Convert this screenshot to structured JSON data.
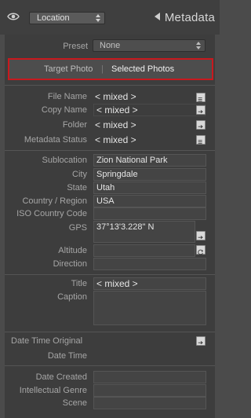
{
  "header": {
    "location_select": "Location",
    "panel_title": "Metadata"
  },
  "preset": {
    "label": "Preset",
    "value": "None"
  },
  "target": {
    "target_photo": "Target Photo",
    "separator": "|",
    "selected_photos": "Selected Photos"
  },
  "file_info": {
    "file_name": {
      "label": "File Name",
      "value": "< mixed >"
    },
    "copy_name": {
      "label": "Copy Name",
      "value": "< mixed >"
    },
    "folder": {
      "label": "Folder",
      "value": "< mixed >"
    },
    "metadata_status": {
      "label": "Metadata Status",
      "value": "< mixed >"
    }
  },
  "location": {
    "sublocation": {
      "label": "Sublocation",
      "value": "Zion National Park"
    },
    "city": {
      "label": "City",
      "value": "Springdale"
    },
    "state": {
      "label": "State",
      "value": "Utah"
    },
    "country": {
      "label": "Country / Region",
      "value": "USA"
    },
    "iso": {
      "label": "ISO Country Code",
      "value": ""
    },
    "gps": {
      "label": "GPS",
      "value": "37°13'3.228\" N"
    },
    "altitude": {
      "label": "Altitude",
      "value": ""
    },
    "direction": {
      "label": "Direction",
      "value": ""
    }
  },
  "content_info": {
    "title": {
      "label": "Title",
      "value": "< mixed >"
    },
    "caption": {
      "label": "Caption",
      "value": ""
    }
  },
  "dates": {
    "date_time_original": {
      "label": "Date Time Original"
    },
    "date_time": {
      "label": "Date Time"
    }
  },
  "other": {
    "date_created": {
      "label": "Date Created",
      "value": ""
    },
    "intellectual_genre": {
      "label": "Intellectual Genre",
      "value": ""
    },
    "scene": {
      "label": "Scene",
      "value": ""
    }
  },
  "colors": {
    "highlight_border": "#c8191e"
  }
}
